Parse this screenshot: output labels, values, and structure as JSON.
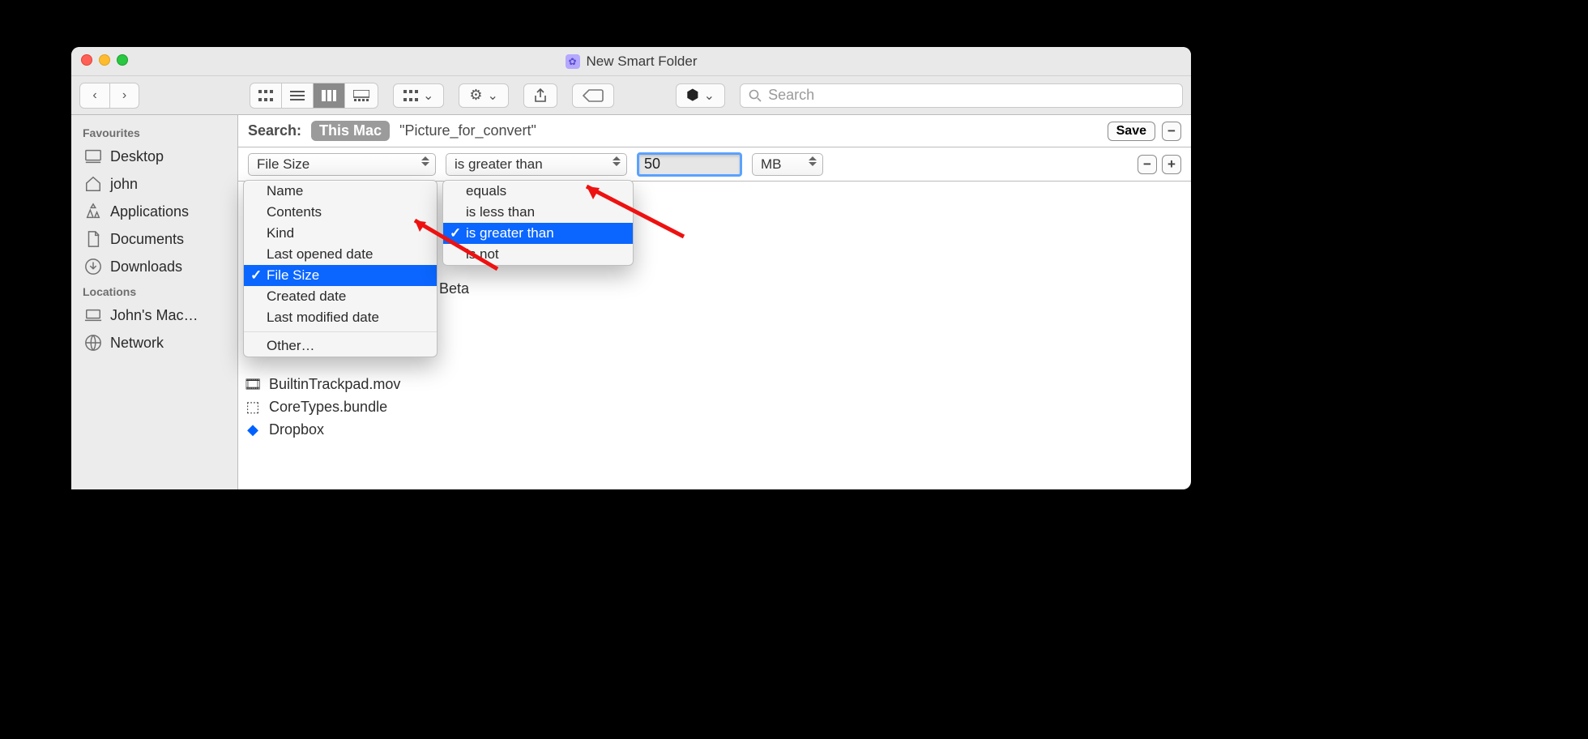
{
  "window": {
    "title": "New Smart Folder"
  },
  "toolbar": {
    "search_placeholder": "Search",
    "action_icon": "gear-icon",
    "share_icon": "share-icon",
    "tag_icon": "tag-icon",
    "cloud_service_icon": "dropbox-icon"
  },
  "sidebar": {
    "sections": [
      {
        "title": "Favourites",
        "items": [
          {
            "icon": "desktop-icon",
            "label": "Desktop"
          },
          {
            "icon": "home-icon",
            "label": "john"
          },
          {
            "icon": "apps-icon",
            "label": "Applications"
          },
          {
            "icon": "docs-icon",
            "label": "Documents"
          },
          {
            "icon": "downloads-icon",
            "label": "Downloads"
          }
        ]
      },
      {
        "title": "Locations",
        "items": [
          {
            "icon": "laptop-icon",
            "label": "John's Mac…"
          },
          {
            "icon": "network-icon",
            "label": "Network"
          }
        ]
      }
    ]
  },
  "searchbar": {
    "label": "Search:",
    "scope_selected": "This Mac",
    "scope_folder": "\"Picture_for_convert\"",
    "save_label": "Save"
  },
  "rule": {
    "attribute_selected": "File Size",
    "comparator_selected": "is greater than",
    "value": "50",
    "unit_selected": "MB"
  },
  "attr_menu": {
    "items": [
      "Name",
      "Contents",
      "Kind",
      "Last opened date",
      "File Size",
      "Created date",
      "Last modified date"
    ],
    "selected_index": 4,
    "other_label": "Other…"
  },
  "comp_menu": {
    "items": [
      "equals",
      "is less than",
      "is greater than",
      "is not"
    ],
    "selected_index": 2
  },
  "files": {
    "partial_beta": "Beta",
    "visible": [
      {
        "icon": "file-mov-icon",
        "name": "BuiltinTrackpad.mov"
      },
      {
        "icon": "bundle-icon",
        "name": "CoreTypes.bundle"
      },
      {
        "icon": "dropbox-icon",
        "name": "Dropbox"
      }
    ]
  }
}
